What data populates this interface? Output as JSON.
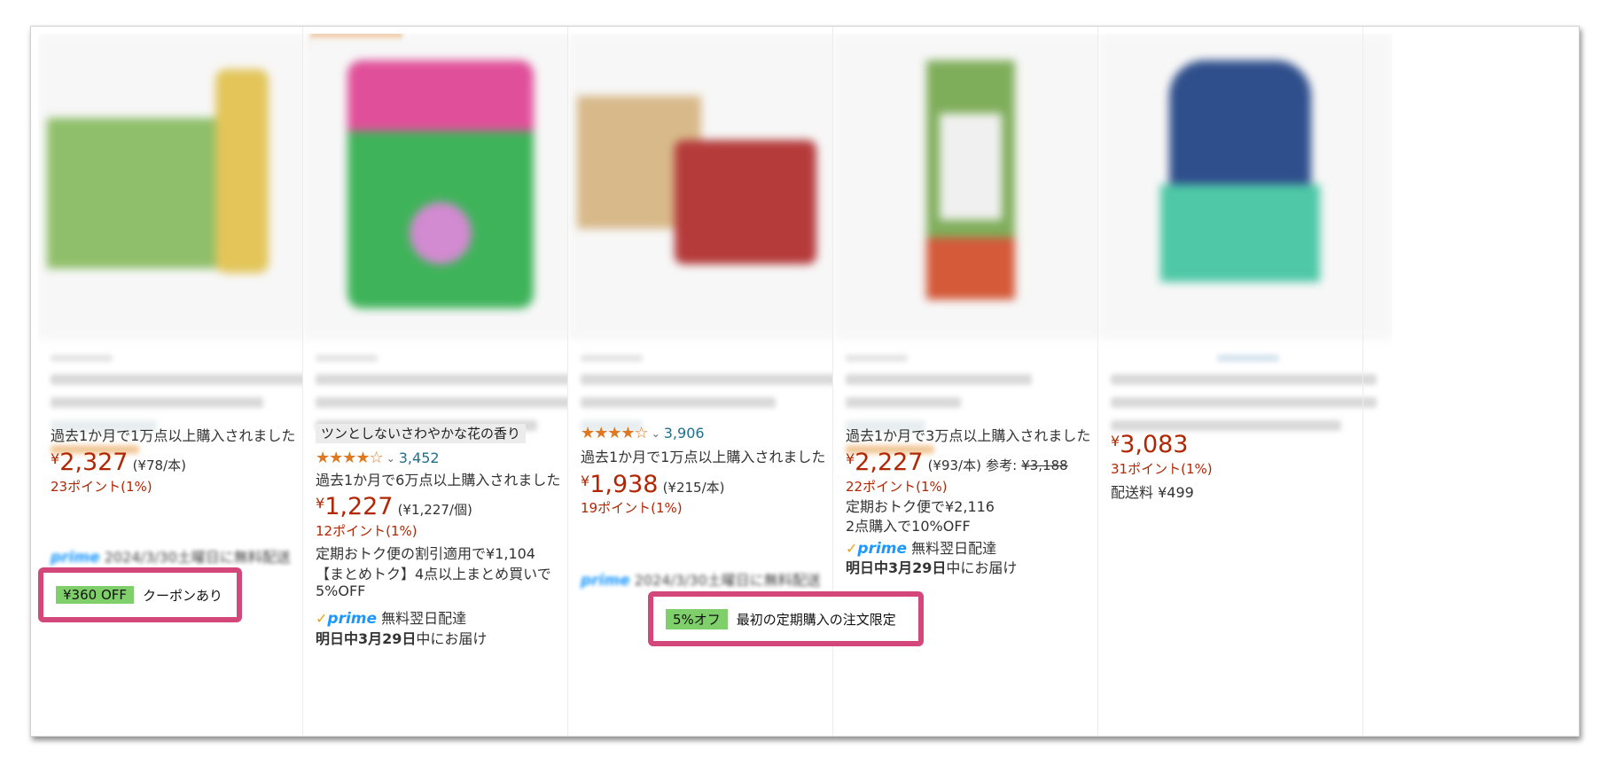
{
  "products": [
    {
      "bought_text": "過去1か月で1万点以上購入されました",
      "price": "2,327",
      "currency": "¥",
      "unit_price": "(¥78/本)",
      "points": "23ポイント(1%)",
      "coupon_badge": "¥360 OFF",
      "coupon_label": "クーポンあり",
      "delivery_text": "に無料配送"
    },
    {
      "tag": "ツンとしないさわやかな花の香り",
      "stars": "★★★★☆",
      "rating_count": "3,452",
      "bought_text": "過去1か月で6万点以上購入されました",
      "price": "1,227",
      "currency": "¥",
      "unit_price": "(¥1,227/個)",
      "points": "12ポイント(1%)",
      "subscribe_text": "定期おトク便の割引適用で¥1,104",
      "bulk_text_1": "【まとめトク】4点以上まとめ買いで",
      "bulk_text_2": "5%OFF",
      "prime_check": "✓",
      "prime_word": "prime",
      "prime_text": "無料翌日配達",
      "delivery_date_bold": "明日中3月29日",
      "delivery_date_rest": "中にお届け"
    },
    {
      "stars": "★★★★☆",
      "rating_count": "3,906",
      "bought_text": "過去1か月で1万点以上購入されました",
      "price": "1,938",
      "currency": "¥",
      "unit_price": "(¥215/本)",
      "points": "19ポイント(1%)",
      "offer_badge": "5%オフ",
      "offer_label": "最初の定期購入の注文限定",
      "delivery_text": "2024/3/30土曜日に無料配送"
    },
    {
      "bought_text": "過去1か月で3万点以上購入されました",
      "price": "2,227",
      "currency": "¥",
      "unit_price": "(¥93/本)",
      "ref_label": "参考:",
      "ref_price": "¥3,188",
      "points": "22ポイント(1%)",
      "subscribe_text": "定期おトク便で¥2,116",
      "bulk_text": "2点購入で10%OFF",
      "prime_check": "✓",
      "prime_word": "prime",
      "prime_text": "無料翌日配達",
      "delivery_date_bold": "明日中3月29日",
      "delivery_date_rest": "中にお届け"
    },
    {
      "price": "3,083",
      "currency": "¥",
      "points": "31ポイント(1%)",
      "shipping": "配送料 ¥499"
    }
  ],
  "colors": {
    "price_red": "#b12704",
    "highlight_pink": "#d4477a",
    "badge_green": "#7fcf6b",
    "link_teal": "#1f6f8b",
    "prime_blue": "#1a98ff",
    "star_orange": "#de7921"
  }
}
